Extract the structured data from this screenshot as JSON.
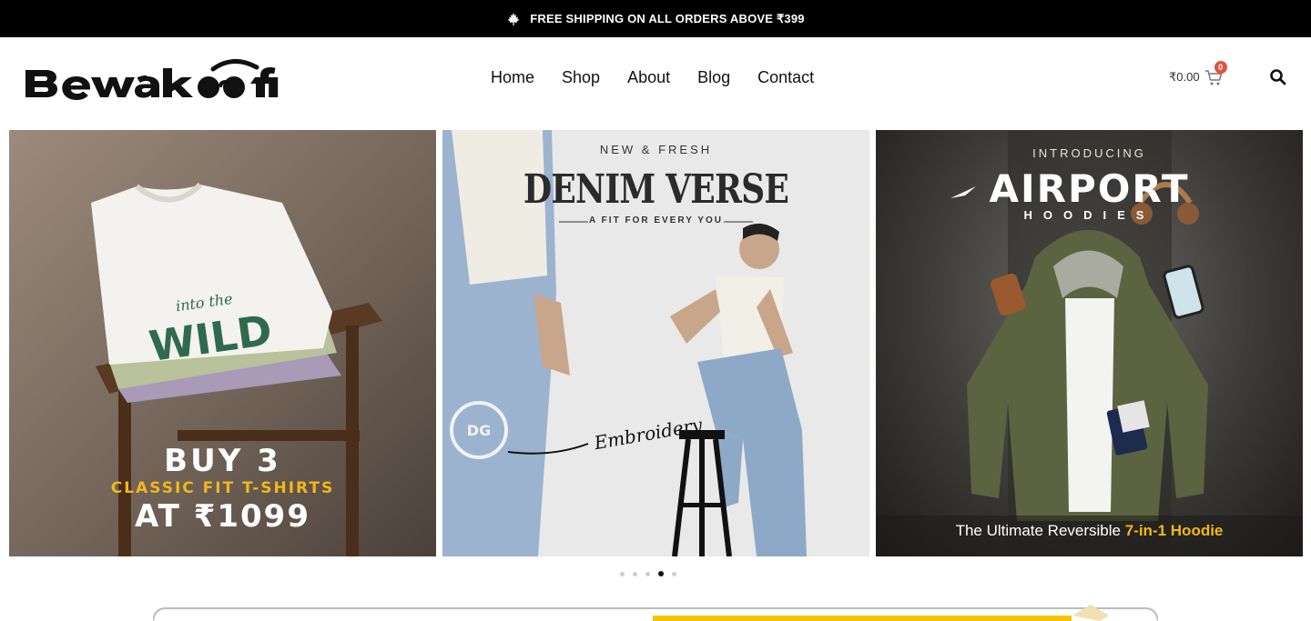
{
  "announcement": {
    "text": "FREE SHIPPING ON ALL ORDERS ABOVE ₹399",
    "icon": "maple-leaf-icon"
  },
  "brand": {
    "name": "Bewakoof"
  },
  "nav": {
    "items": [
      "Home",
      "Shop",
      "About",
      "Blog",
      "Contact"
    ]
  },
  "cart": {
    "total": "₹0.00",
    "count": "0",
    "icon": "shopping-cart-icon"
  },
  "search": {
    "icon": "search-icon"
  },
  "banners": [
    {
      "line1": "BUY 3",
      "line2": "CLASSIC FIT T-SHIRTS",
      "line3": "AT ₹1099",
      "tee_graphic": "into the WILD"
    },
    {
      "kicker": "NEW & FRESH",
      "title": "DENIM VERSE",
      "subtitle": "A FIT FOR EVERY YOU",
      "callout": "Embroidery"
    },
    {
      "kicker": "INTRODUCING",
      "title": "AIRPORT",
      "subtitle": "HOODIES",
      "tagline_prefix": "The Ultimate Reversible ",
      "tagline_highlight": "7-in-1 Hoodie"
    }
  ],
  "carousel": {
    "total_slides": 5,
    "active_slide": 4
  },
  "colors": {
    "accent": "#f1b81a",
    "badge": "#e0533f",
    "topbar": "#000000"
  }
}
